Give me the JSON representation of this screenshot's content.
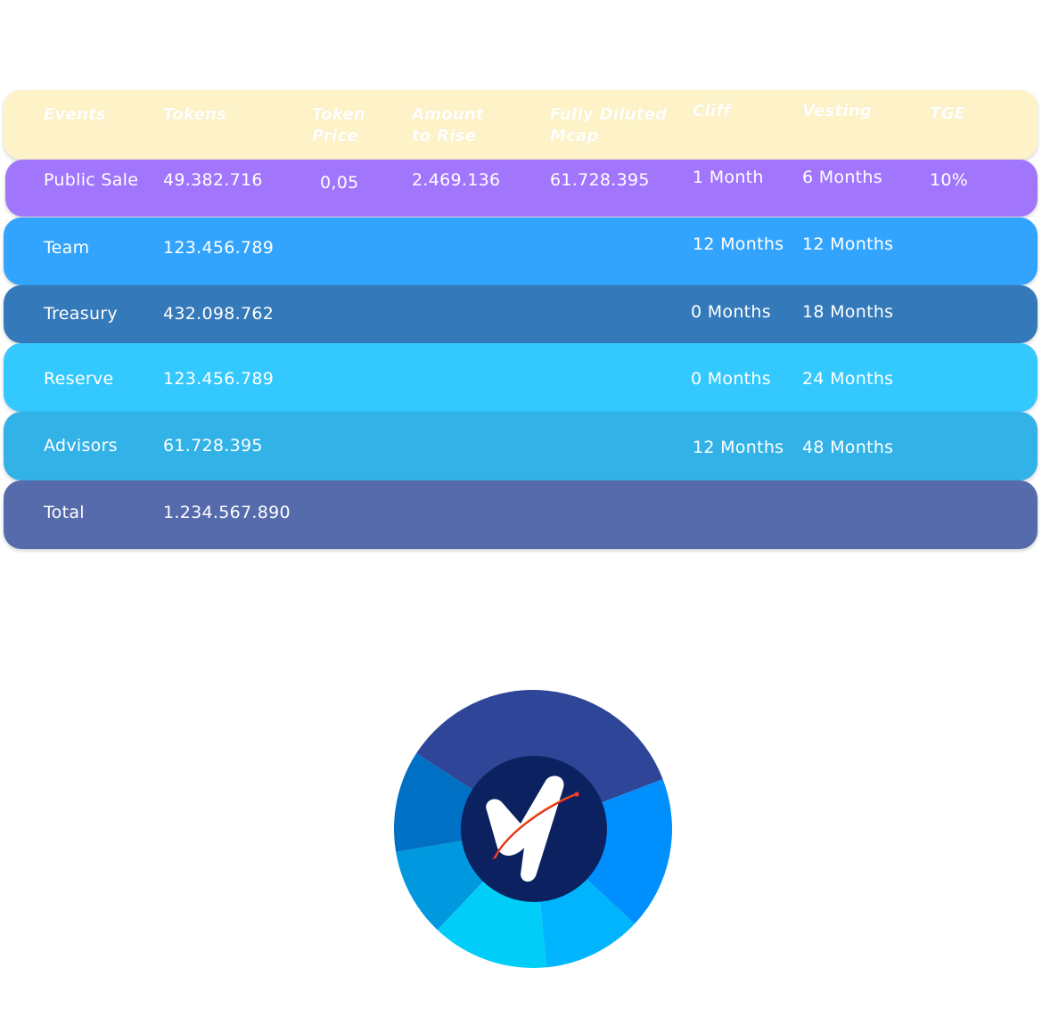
{
  "headers": {
    "events": "Events",
    "tokens": "Tokens",
    "token_price": "Token Price",
    "amount_to_rise": "Amount to Rise",
    "fully_diluted_mcap": "Fully Diluted Mcap",
    "cliff": "Cliff",
    "vesting": "Vesting",
    "tge": "TGE"
  },
  "rows": [
    {
      "event": "Public Sale",
      "tokens": "49.382.716",
      "token_price": "0,05",
      "amount_to_rise": "2.469.136",
      "fully_diluted_mcap": "61.728.395",
      "cliff": "1 Month",
      "vesting": "6 Months",
      "tge": "10%"
    },
    {
      "event": "Team",
      "tokens": "123.456.789",
      "cliff": "12 Months",
      "vesting": "12 Months"
    },
    {
      "event": "Treasury",
      "tokens": "432.098.762",
      "cliff": "0 Months",
      "vesting": "18 Months"
    },
    {
      "event": "Reserve",
      "tokens": "123.456.789",
      "cliff": "0 Months",
      "vesting": "24 Months"
    },
    {
      "event": "Advisors",
      "tokens": "61.728.395",
      "cliff": "12 Months",
      "vesting": "48 Months"
    },
    {
      "event": "Total",
      "tokens": "1.234.567.890"
    }
  ],
  "colors": {
    "header_bg": "#fef3c8",
    "public_sale": "#a176fd",
    "team": "#33a4fe",
    "treasury": "#3479b9",
    "reserve": "#33c8fe",
    "advisors": "#33b2e8",
    "total": "#566bac",
    "logo_bg": "#0b2160"
  },
  "donut_segments": [
    {
      "color": "#2e4598",
      "value": 35.0
    },
    {
      "color": "#0090fd",
      "value": 17.8
    },
    {
      "color": "#00b5fe",
      "value": 11.5
    },
    {
      "color": "#00cef8",
      "value": 13.6
    },
    {
      "color": "#0099e0",
      "value": 10.3
    },
    {
      "color": "#0070c4",
      "value": 11.8
    }
  ]
}
